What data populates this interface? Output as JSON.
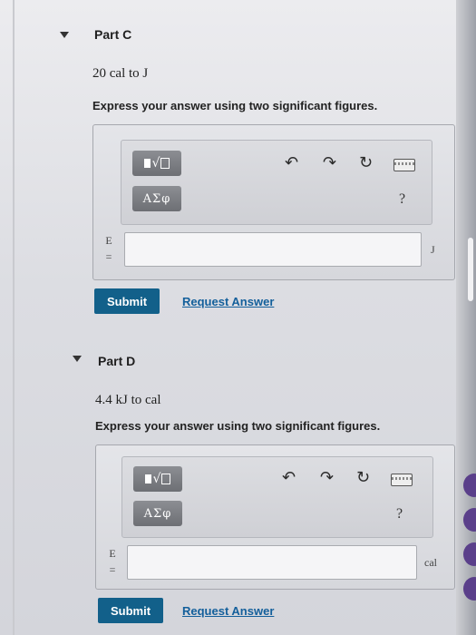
{
  "parts": [
    {
      "header": "Part C",
      "question": "20 cal to J",
      "instruction": "Express your answer using two significant figures.",
      "toolbar": {
        "templates_icon": "fraction-radical-template-icon",
        "greek_label": "ΑΣφ",
        "undo_icon": "undo-icon",
        "redo_icon": "redo-icon",
        "reset_icon": "reset-icon",
        "keyboard_icon": "keyboard-icon",
        "help_label": "?"
      },
      "variable_label": "E",
      "equals": "=",
      "input_value": "",
      "unit": "J",
      "submit_label": "Submit",
      "request_label": "Request Answer"
    },
    {
      "header": "Part D",
      "question": "4.4 kJ to cal",
      "instruction": "Express your answer using two significant figures.",
      "toolbar": {
        "templates_icon": "fraction-radical-template-icon",
        "greek_label": "ΑΣφ",
        "undo_icon": "undo-icon",
        "redo_icon": "redo-icon",
        "reset_icon": "reset-icon",
        "keyboard_icon": "keyboard-icon",
        "help_label": "?"
      },
      "variable_label": "E",
      "equals": "=",
      "input_value": "",
      "unit": "cal",
      "submit_label": "Submit",
      "request_label": "Request Answer"
    }
  ],
  "colors": {
    "submit_bg": "#12608a",
    "link": "#135f9b",
    "tool_btn": "#7a7c81"
  }
}
